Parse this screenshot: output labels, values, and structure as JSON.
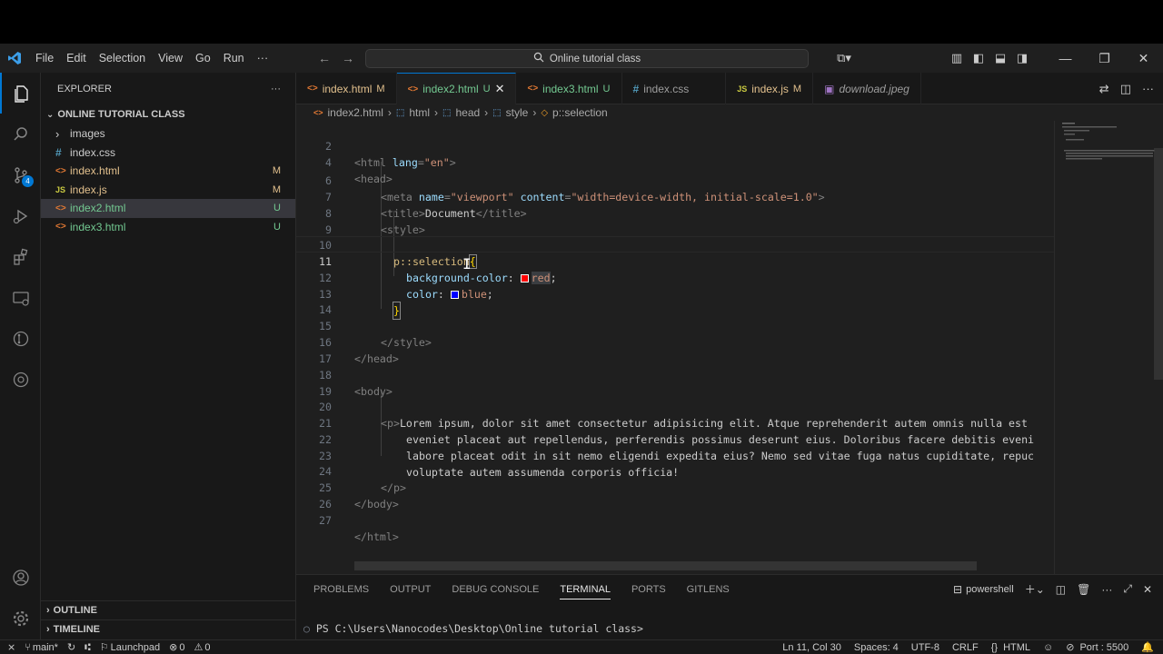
{
  "titlebar": {
    "logo": "VS Code logo",
    "menu": [
      "File",
      "Edit",
      "Selection",
      "View",
      "Go",
      "Run",
      "···"
    ],
    "search_label": "Online tutorial class"
  },
  "sidebar": {
    "header": "EXPLORER",
    "header_more": "···",
    "folder": "ONLINE TUTORIAL CLASS",
    "items": [
      {
        "icon": "›",
        "label": "images",
        "status": "",
        "kind": "folder"
      },
      {
        "icon": "#",
        "label": "index.css",
        "status": "",
        "kind": "css"
      },
      {
        "icon": "<>",
        "label": "index.html",
        "status": "M",
        "kind": "html-mod"
      },
      {
        "icon": "JS",
        "label": "index.js",
        "status": "M",
        "kind": "js-mod"
      },
      {
        "icon": "<>",
        "label": "index2.html",
        "status": "U",
        "kind": "html-new"
      },
      {
        "icon": "<>",
        "label": "index3.html",
        "status": "U",
        "kind": "html-new"
      }
    ],
    "outline": "OUTLINE",
    "timeline": "TIMELINE"
  },
  "tabs": [
    {
      "label": "index.html",
      "status": "M"
    },
    {
      "label": "index2.html",
      "status": "U"
    },
    {
      "label": "index3.html",
      "status": "U"
    },
    {
      "label": "index.css",
      "status": ""
    },
    {
      "label": "index.js",
      "status": "M"
    },
    {
      "label": "download.jpeg",
      "status": ""
    }
  ],
  "breadcrumb": [
    "index2.html",
    "html",
    "head",
    "style",
    "p::selection"
  ],
  "editor": {
    "line_numbers": [
      "2",
      "4",
      "6",
      "7",
      "8",
      "9",
      "10",
      "11",
      "12",
      "13",
      "14",
      "15",
      "16",
      "17",
      "18",
      "19",
      "20",
      "21",
      "22",
      "23",
      "24",
      "25",
      "26",
      "27"
    ],
    "code": {
      "l2_tag": "<html",
      "l2_attr": " lang",
      "l2_eq": "=",
      "l2_val": "\"en\"",
      "l2_end": ">",
      "l4": "<head>",
      "l6_open": "<meta",
      "l6_a1": " name",
      "l6_v1": "\"viewport\"",
      "l6_a2": " content",
      "l6_v2": "\"width=device-width, initial-scale=1.0\"",
      "l6_close": ">",
      "l7_open": "<title>",
      "l7_text": "Document",
      "l7_close": "</title>",
      "l8": "<style>",
      "l10_sel": "p::selection",
      "l10_brace": "{",
      "l11_prop": "background-color",
      "l11_colon": ": ",
      "l11_val": "red",
      "l11_semi": ";",
      "l12_prop": "color",
      "l12_colon": ": ",
      "l12_val": "blue",
      "l12_semi": ";",
      "l13_brace": "}",
      "l15": "</style>",
      "l16": "</head>",
      "l18": "<body>",
      "l20_tag": "<p>",
      "l20_text": "Lorem ipsum, dolor sit amet consectetur adipisicing elit. Atque reprehenderit autem omnis nulla est",
      "l21_text": "eveniet placeat aut repellendus, perferendis possimus deserunt eius. Doloribus facere debitis eveni",
      "l22_text": "labore placeat odit in sit nemo eligendi expedita eius? Nemo sed vitae fuga natus cupiditate, repuc",
      "l23_text": "voluptate autem assumenda corporis officia!",
      "l24": "</p>",
      "l25": "</body>",
      "l27": "</html>"
    },
    "swatch_red": "#ff0000",
    "swatch_blue": "#0000ff"
  },
  "panel": {
    "tabs": [
      "PROBLEMS",
      "OUTPUT",
      "DEBUG CONSOLE",
      "TERMINAL",
      "PORTS",
      "GITLENS"
    ],
    "shell": "powershell",
    "prompt": "PS C:\\Users\\Nanocodes\\Desktop\\Online tutorial class>"
  },
  "status": {
    "remote": "⨯",
    "branch": "main*",
    "launchpad": "Launchpad",
    "errors": "0",
    "warnings": "0",
    "position": "Ln 11, Col 30",
    "spaces": "Spaces: 4",
    "encoding": "UTF-8",
    "eol": "CRLF",
    "language": "HTML",
    "port": "Port : 5500"
  }
}
